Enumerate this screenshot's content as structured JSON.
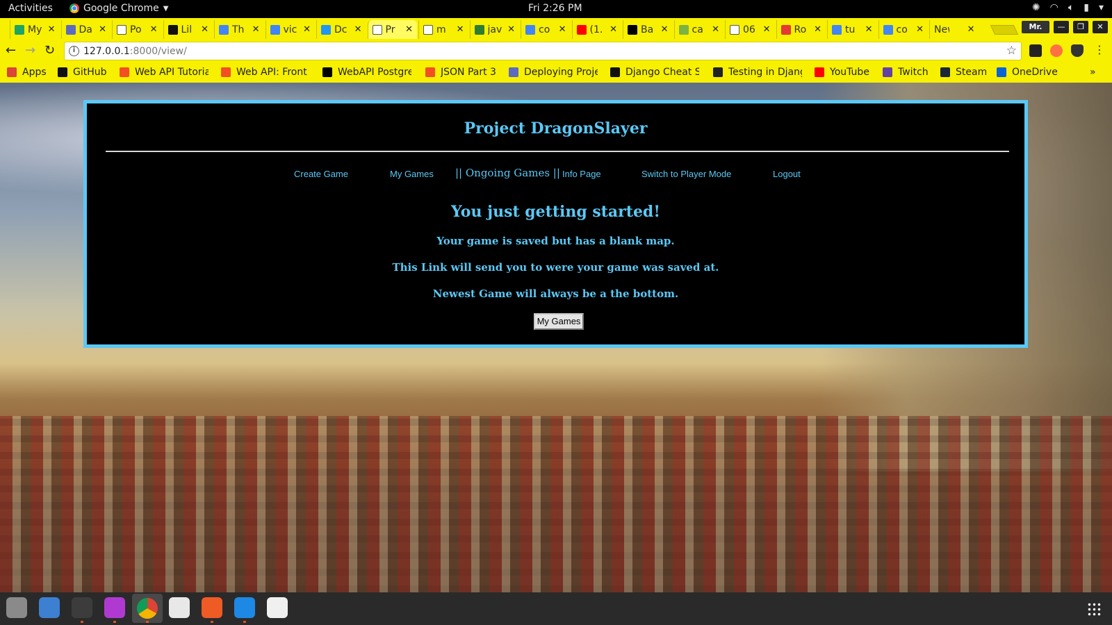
{
  "system": {
    "activities": "Activities",
    "app_name": "Google Chrome",
    "clock": "Fri  2:26 PM"
  },
  "browser": {
    "tabs": [
      {
        "label": "My",
        "icon_color": "#1fa463",
        "icon": "drive-icon"
      },
      {
        "label": "Da",
        "icon_color": "#5c6bc0",
        "icon": "docs-icon"
      },
      {
        "label": "Po",
        "icon_color": "#ffffff",
        "icon": "page-icon"
      },
      {
        "label": "Lil",
        "icon_color": "#111111",
        "icon": "github-icon"
      },
      {
        "label": "Th",
        "icon_color": "#4285f4",
        "icon": "google-icon"
      },
      {
        "label": "vic",
        "icon_color": "#4285f4",
        "icon": "google-icon"
      },
      {
        "label": "Dc",
        "icon_color": "#2196f3",
        "icon": "docker-icon"
      },
      {
        "label": "Pr",
        "icon_color": "#ffffff",
        "icon": "page-icon",
        "active": true
      },
      {
        "label": "m",
        "icon_color": "#ffffff",
        "icon": "page-icon"
      },
      {
        "label": "jav",
        "icon_color": "#2e7d32",
        "icon": "cloud-icon"
      },
      {
        "label": "co",
        "icon_color": "#4285f4",
        "icon": "google-icon"
      },
      {
        "label": "(1.",
        "icon_color": "#ff0000",
        "icon": "youtube-icon"
      },
      {
        "label": "Ba",
        "icon_color": "#000000",
        "icon": "b-icon"
      },
      {
        "label": "ca",
        "icon_color": "#7cb342",
        "icon": "cucumber-icon"
      },
      {
        "label": "06",
        "icon_color": "#ffffff",
        "icon": "page-icon"
      },
      {
        "label": "Ro",
        "icon_color": "#e53935",
        "icon": "react-icon"
      },
      {
        "label": "tu",
        "icon_color": "#4285f4",
        "icon": "google-icon"
      },
      {
        "label": "co",
        "icon_color": "#4285f4",
        "icon": "google-icon"
      },
      {
        "label": "New",
        "icon_color": "",
        "icon": ""
      }
    ],
    "profile_label": "Mr.",
    "url_host": "127.0.0.1",
    "url_rest": ":8000/view/",
    "bookmarks": [
      {
        "label": "Apps",
        "icon": "apps-icon",
        "icon_color": "#db4437"
      },
      {
        "label": "GitHub",
        "icon": "github-icon",
        "icon_color": "#111111"
      },
      {
        "label": "Web API Tutoria",
        "icon": "microsoft-icon",
        "icon_color": "#f25022"
      },
      {
        "label": "Web API: Front",
        "icon": "microsoft-icon",
        "icon_color": "#f25022"
      },
      {
        "label": "WebAPI Postgre",
        "icon": "medium-icon",
        "icon_color": "#000000"
      },
      {
        "label": "JSON Part 3",
        "icon": "microsoft-icon",
        "icon_color": "#f25022"
      },
      {
        "label": "Deploying Proje",
        "icon": "docs-icon",
        "icon_color": "#5c6bc0"
      },
      {
        "label": "Django Cheat Sh",
        "icon": "github-icon",
        "icon_color": "#111111"
      },
      {
        "label": "Testing in Djang",
        "icon": "gear-icon",
        "icon_color": "#222222"
      },
      {
        "label": "YouTube",
        "icon": "youtube-icon",
        "icon_color": "#ff0000"
      },
      {
        "label": "Twitch",
        "icon": "twitch-icon",
        "icon_color": "#6441a5"
      },
      {
        "label": "Steam",
        "icon": "steam-icon",
        "icon_color": "#1b2838"
      },
      {
        "label": "OneDrive",
        "icon": "onedrive-icon",
        "icon_color": "#0a64d8"
      }
    ],
    "more_bookmarks": "»"
  },
  "site": {
    "title": "Project DragonSlayer",
    "nav": [
      {
        "label": "Create Game"
      },
      {
        "label": "My Games"
      },
      {
        "label": "|| Ongoing Games ||",
        "current": true
      },
      {
        "label": "Info Page"
      },
      {
        "label": "Switch to Player Mode"
      },
      {
        "label": "Logout"
      }
    ],
    "heading": "You just getting started!",
    "messages": [
      "Your game is saved but has a blank map.",
      "This Link will send you to were your game was saved at.",
      "Newest Game will always be a the bottom."
    ],
    "button_label": "My Games",
    "accent_color": "#5bc8f5"
  },
  "dock": {
    "apps": [
      {
        "name": "files-icon",
        "color": "#8a8a8a"
      },
      {
        "name": "help-icon",
        "color": "#3d7fd1"
      },
      {
        "name": "terminal-icon",
        "color": "#3c3c3c"
      },
      {
        "name": "intellij-icon",
        "color": "#b03ad1"
      },
      {
        "name": "chrome-icon",
        "color": "#4285f4",
        "active": true
      },
      {
        "name": "slack-icon",
        "color": "#e8e8e8"
      },
      {
        "name": "postman-icon",
        "color": "#ef5b25"
      },
      {
        "name": "vscode-icon",
        "color": "#1e88e5"
      },
      {
        "name": "text-editor-icon",
        "color": "#f0f0f0"
      }
    ]
  }
}
